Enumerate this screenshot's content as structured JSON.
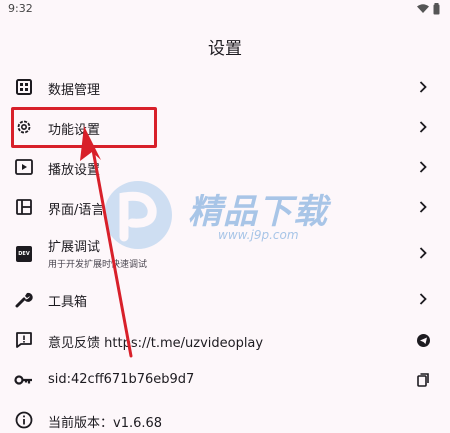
{
  "status_bar": {
    "time": "9:32",
    "icons": [
      "wifi-icon",
      "battery-icon"
    ]
  },
  "page": {
    "title": "设置"
  },
  "settings": [
    {
      "label": "数据管理",
      "icon": "grid-icon",
      "trailing": "chevron-right-icon"
    },
    {
      "label": "功能设置",
      "icon": "gear-icon",
      "trailing": "chevron-right-icon"
    },
    {
      "label": "播放设置",
      "icon": "play-icon",
      "trailing": "chevron-right-icon"
    },
    {
      "label": "界面/语言",
      "icon": "layout-icon",
      "trailing": "chevron-right-icon"
    },
    {
      "label": "扩展调试",
      "sublabel": "用于开发扩展时快速调试",
      "icon": "dev-icon",
      "icon_text": "DEV",
      "trailing": "chevron-right-icon"
    },
    {
      "label": "工具箱",
      "icon": "wrench-icon",
      "trailing": "chevron-right-icon"
    },
    {
      "label": "意见反馈 https://t.me/uzvideoplay",
      "icon": "feedback-icon",
      "trailing": "telegram-icon"
    },
    {
      "label": "sid:42cff671b76eb9d7",
      "icon": "key-icon",
      "trailing": "copy-icon"
    },
    {
      "label": "当前版本：v1.6.68",
      "icon": "info-icon"
    }
  ],
  "watermark": {
    "text": "精品下载",
    "url": "www.j9p.com"
  },
  "colors": {
    "highlight": "#d8202a",
    "background": "#fdf7fa",
    "watermark": "#9fc0e6"
  }
}
